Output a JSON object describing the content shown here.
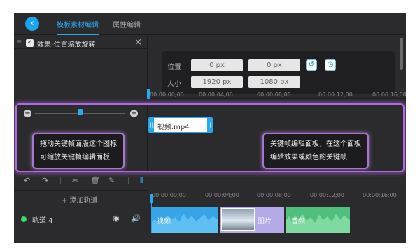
{
  "header": {
    "tabs": [
      {
        "label": "模板素材编辑",
        "active": true
      },
      {
        "label": "属性编辑",
        "active": false
      }
    ]
  },
  "effect_panel": {
    "title": "效果-位置缩放旋转",
    "checked": true,
    "position_label": "位置",
    "position_x": "0 px",
    "position_y": "0 px",
    "size_label": "大小",
    "size_w": "1920 px",
    "size_h": "1080 px"
  },
  "ruler_top": {
    "ticks": [
      "00:00:00;00",
      "00:00:04;00",
      "00:00:08;00",
      "00:00:12;00",
      "00:00:16;00"
    ]
  },
  "keyframe_panel": {
    "clip_label": "视频.mp4",
    "zoom_level": 0.5,
    "tooltip_left": [
      "拖动关键帧面版这个图标",
      "可缩放关键帧编辑面板"
    ],
    "tooltip_right": [
      "关键帧编辑面板，在这个面板",
      "编辑效果或颜色的关键帧"
    ]
  },
  "toolbar": {
    "icons": [
      "undo-icon",
      "redo-icon",
      "cut-icon",
      "delete-icon",
      "edit-icon",
      "split-icon"
    ]
  },
  "timeline": {
    "add_track_label": "+ 添加轨道",
    "ruler_ticks": [
      "00:00:00;00",
      "00:00:04;00",
      "00:00:08;00",
      "00:00:12;00",
      "00:00:16;00"
    ],
    "track_name": "轨道 4",
    "clips": {
      "video": "视频",
      "image": "图片",
      "audio": "音频"
    }
  },
  "colors": {
    "accent": "#2aa8ee",
    "highlight": "#b06adf",
    "video_clip": "#36a4e6",
    "image_clip": "#b5aae8",
    "audio_clip": "#4fbf7e"
  }
}
